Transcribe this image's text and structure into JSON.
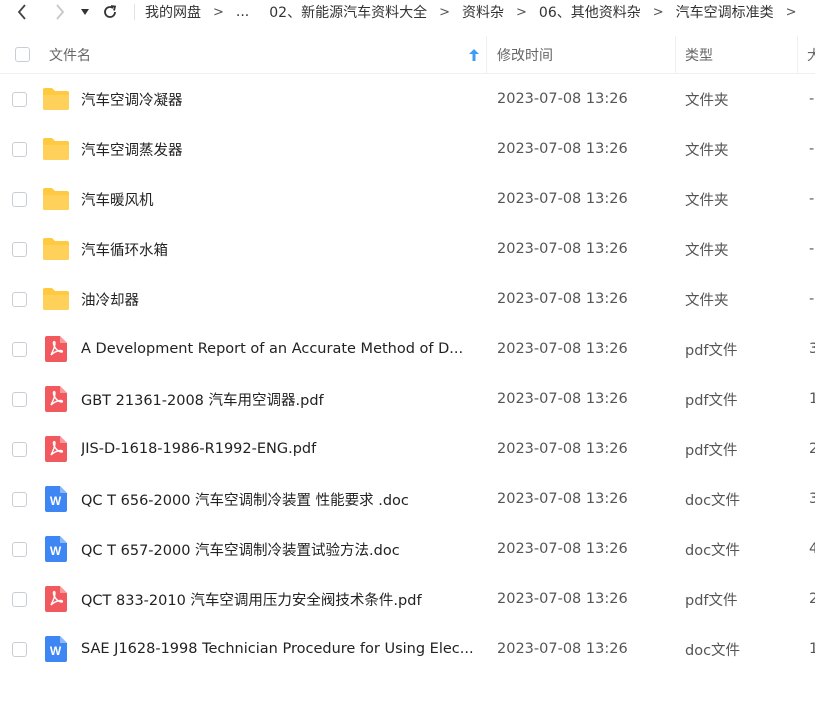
{
  "toolbar": {
    "breadcrumbs": [
      "我的网盘",
      "...",
      "02、新能源汽车资料大全",
      "资料杂",
      "06、其他资料杂",
      "汽车空调标准类"
    ]
  },
  "header": {
    "name": "文件名",
    "time": "修改时间",
    "type": "类型",
    "size": "大"
  },
  "files": [
    {
      "name": "汽车空调冷凝器",
      "time": "2023-07-08 13:26",
      "type": "文件夹",
      "size": "-",
      "icon": "folder-icon"
    },
    {
      "name": "汽车空调蒸发器",
      "time": "2023-07-08 13:26",
      "type": "文件夹",
      "size": "-",
      "icon": "folder-icon"
    },
    {
      "name": "汽车暖风机",
      "time": "2023-07-08 13:26",
      "type": "文件夹",
      "size": "-",
      "icon": "folder-icon"
    },
    {
      "name": "汽车循环水箱",
      "time": "2023-07-08 13:26",
      "type": "文件夹",
      "size": "-",
      "icon": "folder-icon"
    },
    {
      "name": "油冷却器",
      "time": "2023-07-08 13:26",
      "type": "文件夹",
      "size": "-",
      "icon": "folder-icon"
    },
    {
      "name": "A Development Report of an Accurate Method of D...",
      "time": "2023-07-08 13:26",
      "type": "pdf文件",
      "size": "3",
      "icon": "pdf-icon"
    },
    {
      "name": "GBT 21361-2008 汽车用空调器.pdf",
      "time": "2023-07-08 13:26",
      "type": "pdf文件",
      "size": "1",
      "icon": "pdf-icon"
    },
    {
      "name": "JIS-D-1618-1986-R1992-ENG.pdf",
      "time": "2023-07-08 13:26",
      "type": "pdf文件",
      "size": "2",
      "icon": "pdf-icon"
    },
    {
      "name": "QC T 656-2000 汽车空调制冷装置 性能要求 .doc",
      "time": "2023-07-08 13:26",
      "type": "doc文件",
      "size": "3",
      "icon": "doc-icon"
    },
    {
      "name": "QC T 657-2000 汽车空调制冷装置试验方法.doc",
      "time": "2023-07-08 13:26",
      "type": "doc文件",
      "size": "4",
      "icon": "doc-icon"
    },
    {
      "name": "QCT 833-2010 汽车空调用压力安全阀技术条件.pdf",
      "time": "2023-07-08 13:26",
      "type": "pdf文件",
      "size": "2",
      "icon": "pdf-icon"
    },
    {
      "name": "SAE J1628-1998 Technician Procedure for Using Elec...",
      "time": "2023-07-08 13:26",
      "type": "doc文件",
      "size": "1",
      "icon": "doc-icon"
    }
  ],
  "colors": {
    "folder": "#FFC940",
    "pdf": "#F1595F",
    "doc": "#3D86F4",
    "sort_arrow": "#3d9cf5"
  }
}
